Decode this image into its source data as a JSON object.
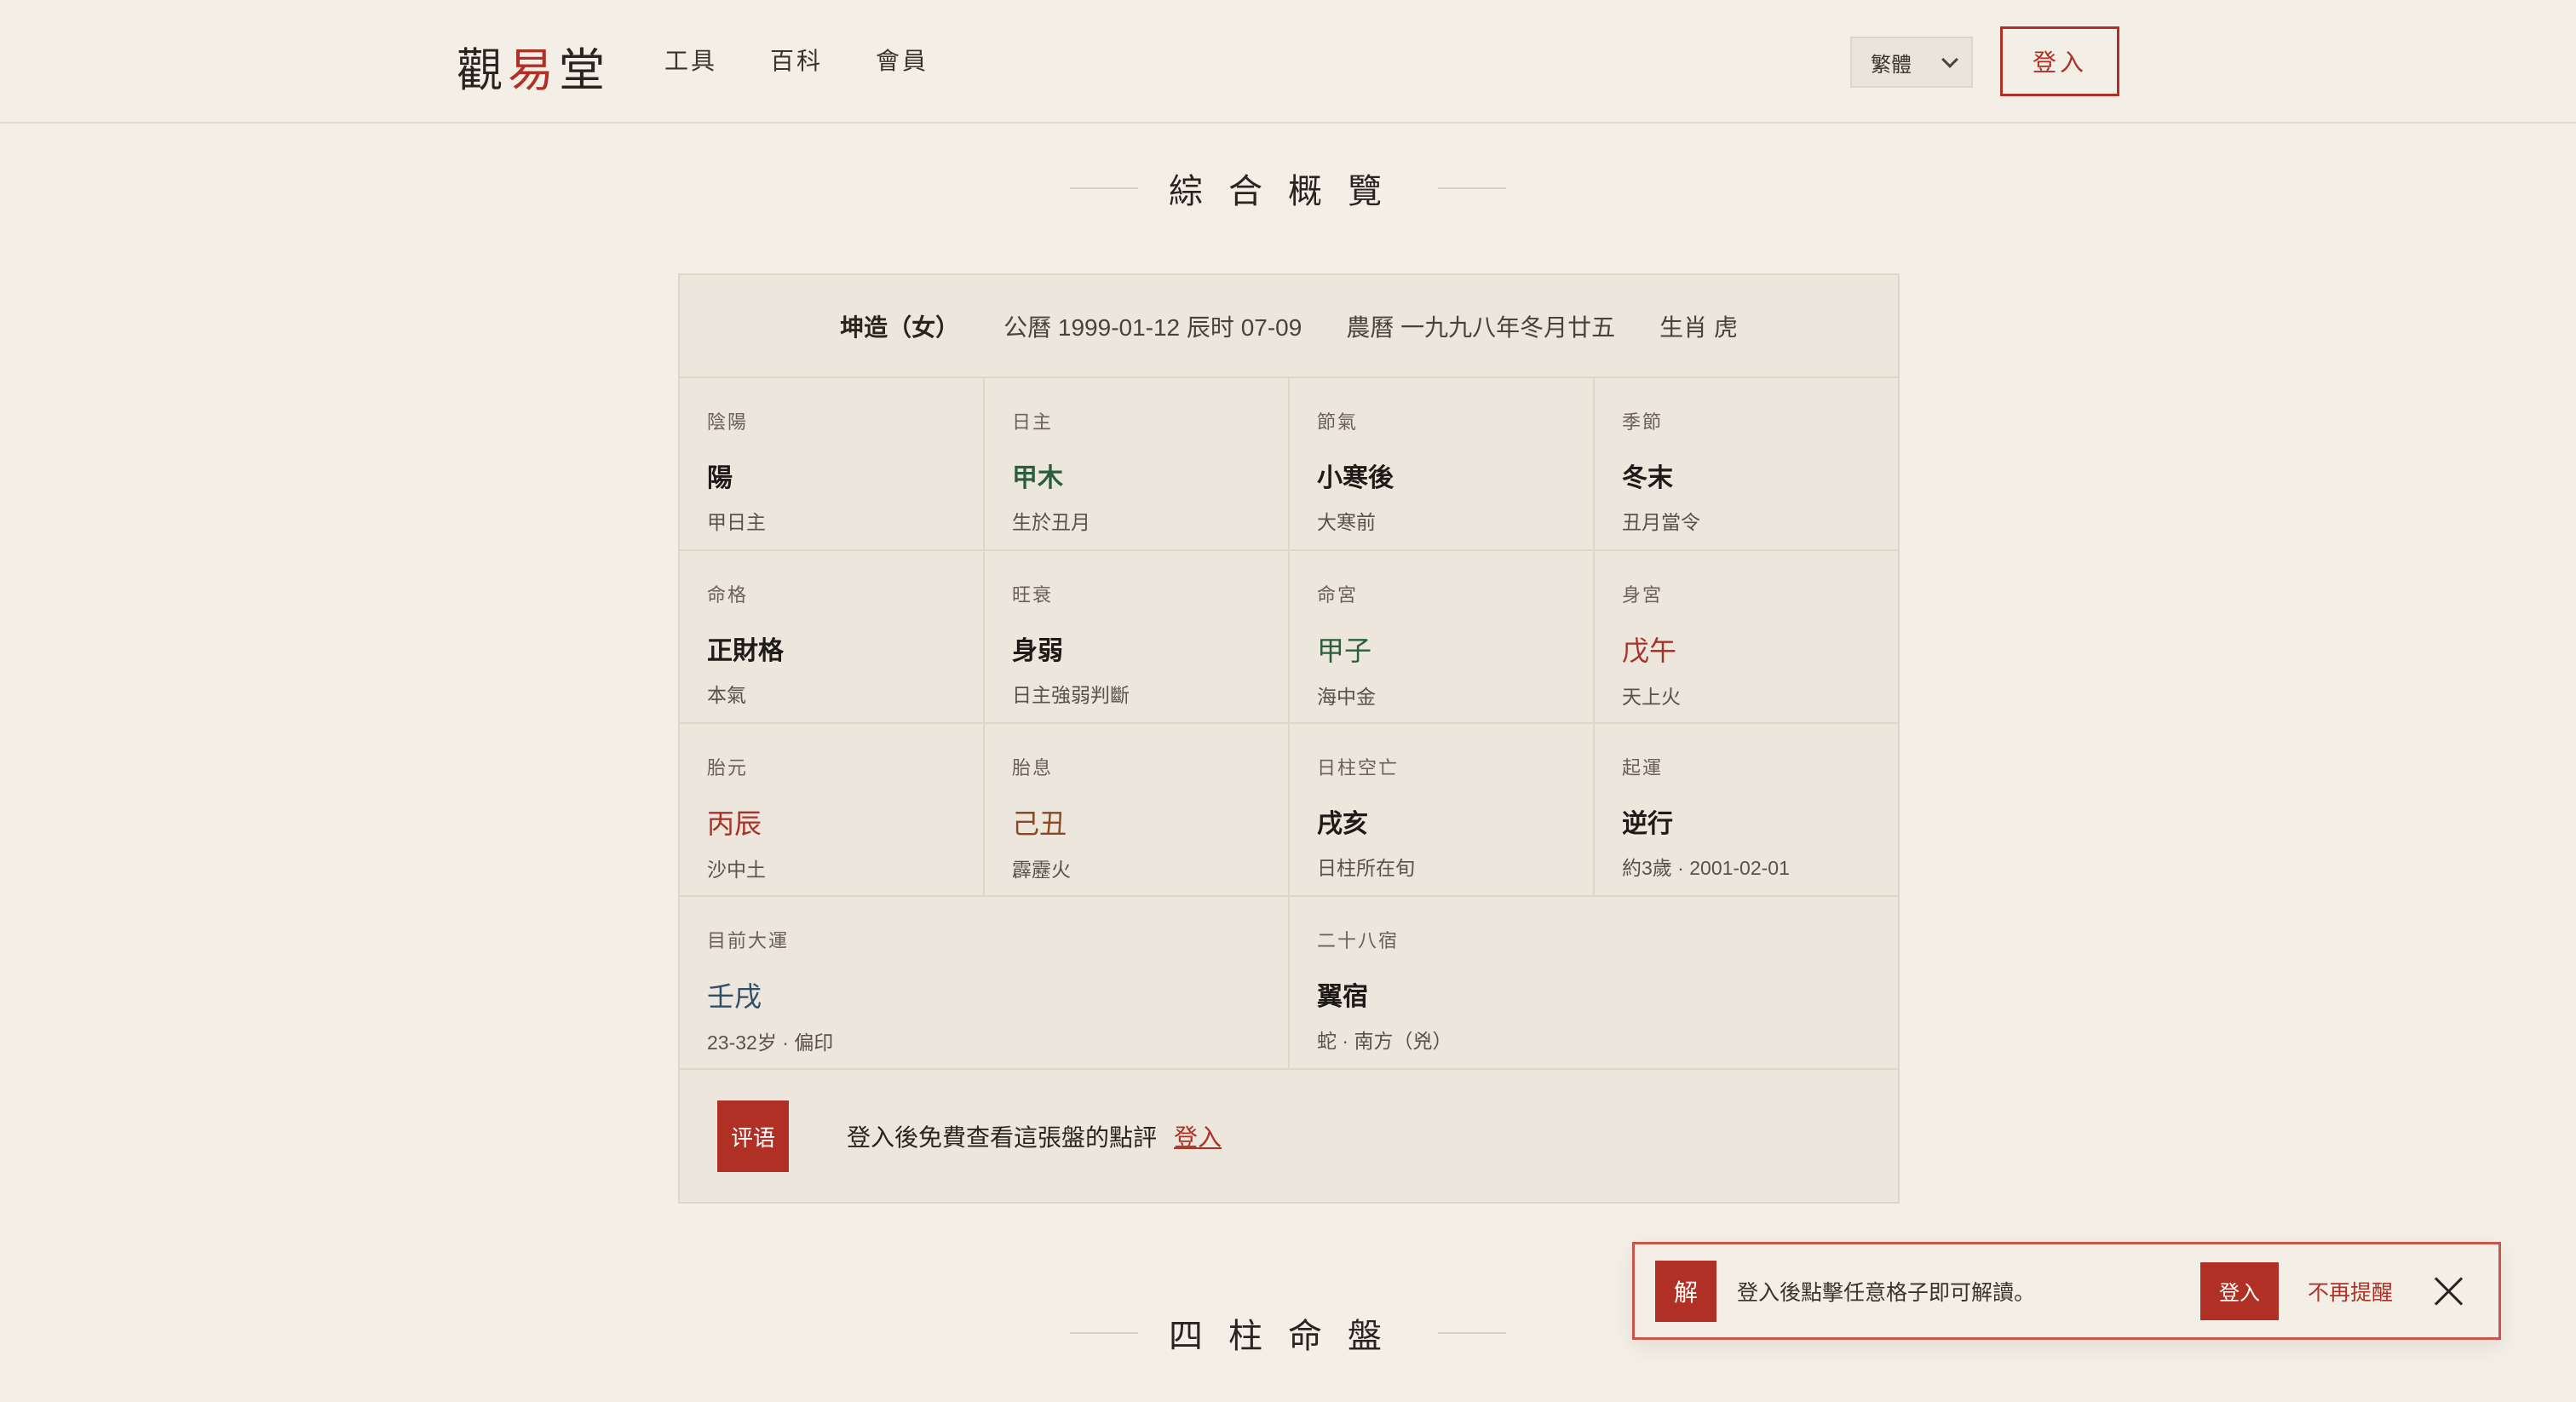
{
  "header": {
    "logo": [
      "觀",
      "易",
      "堂"
    ],
    "nav": [
      "工具",
      "百科",
      "會員"
    ],
    "lang": "繁體",
    "login": "登入"
  },
  "section1": "綜合概覽",
  "section2": "四柱命盤",
  "summary": {
    "gender": "坤造（女）",
    "solar": "公曆 1999-01-12 辰时 07-09",
    "lunar": "農曆 一九九八年冬月廿五",
    "zodiac": "生肖 虎"
  },
  "cells": [
    {
      "label": "陰陽",
      "value": "陽",
      "sub": "甲日主",
      "color": ""
    },
    {
      "label": "日主",
      "value": "甲木",
      "sub": "生於丑月",
      "color": "green"
    },
    {
      "label": "節氣",
      "value": "小寒後",
      "sub": "大寒前",
      "color": ""
    },
    {
      "label": "季節",
      "value": "冬末",
      "sub": "丑月當令",
      "color": ""
    },
    {
      "label": "命格",
      "value": "正財格",
      "sub": "本氣",
      "color": ""
    },
    {
      "label": "旺衰",
      "value": "身弱",
      "sub": "日主強弱判斷",
      "color": ""
    },
    {
      "label": "命宮",
      "value": "甲子",
      "sub": "海中金",
      "color": "green"
    },
    {
      "label": "身宮",
      "value": "戊午",
      "sub": "天上火",
      "color": "red"
    },
    {
      "label": "胎元",
      "value": "丙辰",
      "sub": "沙中土",
      "color": "red"
    },
    {
      "label": "胎息",
      "value": "己丑",
      "sub": "霹靂火",
      "color": "brown"
    },
    {
      "label": "日柱空亡",
      "value": "戌亥",
      "sub": "日柱所在旬",
      "color": ""
    },
    {
      "label": "起運",
      "value": "逆行",
      "sub": "約3歲 · 2001-02-01",
      "color": ""
    },
    {
      "label": "目前大運",
      "value": "壬戌",
      "sub": "23-32岁 · 偏印",
      "color": "blue"
    },
    {
      "label": "二十八宿",
      "value": "翼宿",
      "sub": "蛇 · 南方（兇）",
      "color": ""
    }
  ],
  "comment": {
    "tag": "评语",
    "text": "登入後免費查看這張盤的點評",
    "link": "登入"
  },
  "toast": {
    "badge": "解",
    "message": "登入後點擊任意格子即可解讀。",
    "login": "登入",
    "dismiss": "不再提醒"
  },
  "colors": {
    "accent": "#b03025",
    "background": "#f3efe6",
    "card": "#ece6dc",
    "wood_green": "#2b5e3a",
    "water_blue": "#2f4f68"
  }
}
